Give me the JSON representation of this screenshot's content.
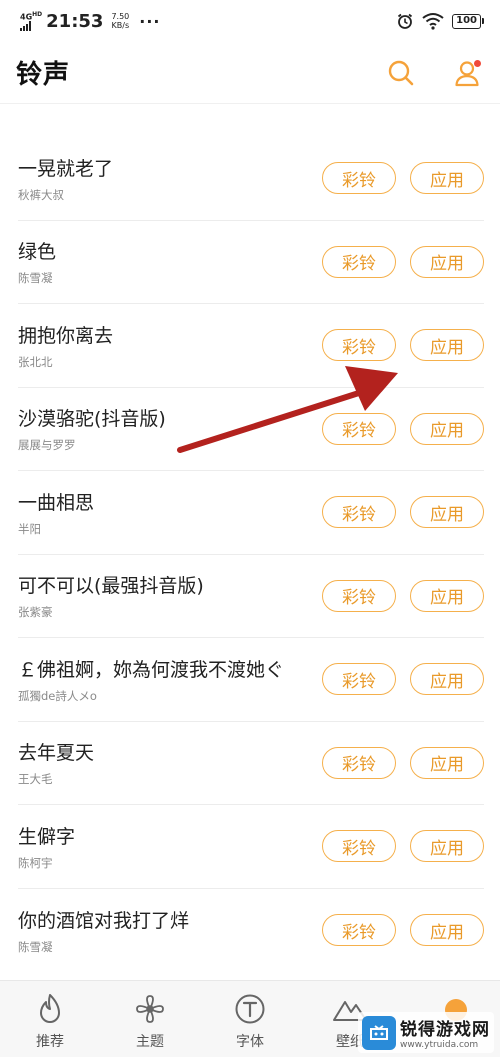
{
  "status_bar": {
    "network": "4G",
    "network_hd": "HD",
    "time": "21:53",
    "speed_value": "7.50",
    "speed_unit": "KB/s",
    "more": "···",
    "battery": "100"
  },
  "header": {
    "title": "铃声",
    "search_icon": "search-icon",
    "profile_icon": "user-icon"
  },
  "list": {
    "items": [
      {
        "title": "一晃就老了",
        "artist": "秋裤大叔",
        "ring_label": "彩铃",
        "apply_label": "应用"
      },
      {
        "title": "绿色",
        "artist": "陈雪凝",
        "ring_label": "彩铃",
        "apply_label": "应用"
      },
      {
        "title": "拥抱你离去",
        "artist": "张北北",
        "ring_label": "彩铃",
        "apply_label": "应用"
      },
      {
        "title": "沙漠骆驼(抖音版)",
        "artist": "展展与罗罗",
        "ring_label": "彩铃",
        "apply_label": "应用"
      },
      {
        "title": "一曲相思",
        "artist": "半阳",
        "ring_label": "彩铃",
        "apply_label": "应用"
      },
      {
        "title": "可不可以(最强抖音版)",
        "artist": "张紫豪",
        "ring_label": "彩铃",
        "apply_label": "应用"
      },
      {
        "title": "￡佛祖婀，妳為何渡我不渡她ぐ",
        "artist": "孤獨de詩人メo",
        "ring_label": "彩铃",
        "apply_label": "应用"
      },
      {
        "title": "去年夏天",
        "artist": "王大毛",
        "ring_label": "彩铃",
        "apply_label": "应用"
      },
      {
        "title": "生僻字",
        "artist": "陈柯宇",
        "ring_label": "彩铃",
        "apply_label": "应用"
      },
      {
        "title": "你的酒馆对我打了烊",
        "artist": "陈雪凝",
        "ring_label": "彩铃",
        "apply_label": "应用"
      }
    ]
  },
  "bottom_nav": {
    "tabs": [
      {
        "label": "推荐",
        "icon": "flame-icon"
      },
      {
        "label": "主题",
        "icon": "pinwheel-icon"
      },
      {
        "label": "字体",
        "icon": "font-icon"
      },
      {
        "label": "壁纸",
        "icon": "mountain-icon"
      },
      {
        "label": "",
        "icon": "ringtone-icon"
      }
    ]
  },
  "watermark": {
    "name": "锐得游戏网",
    "url": "www.ytruida.com"
  },
  "colors": {
    "accent": "#f5a23a",
    "button_border": "#f5b04c",
    "button_text": "#e99a2a",
    "annotation_arrow": "#b3221e",
    "notification_dot": "#f04a3a"
  }
}
